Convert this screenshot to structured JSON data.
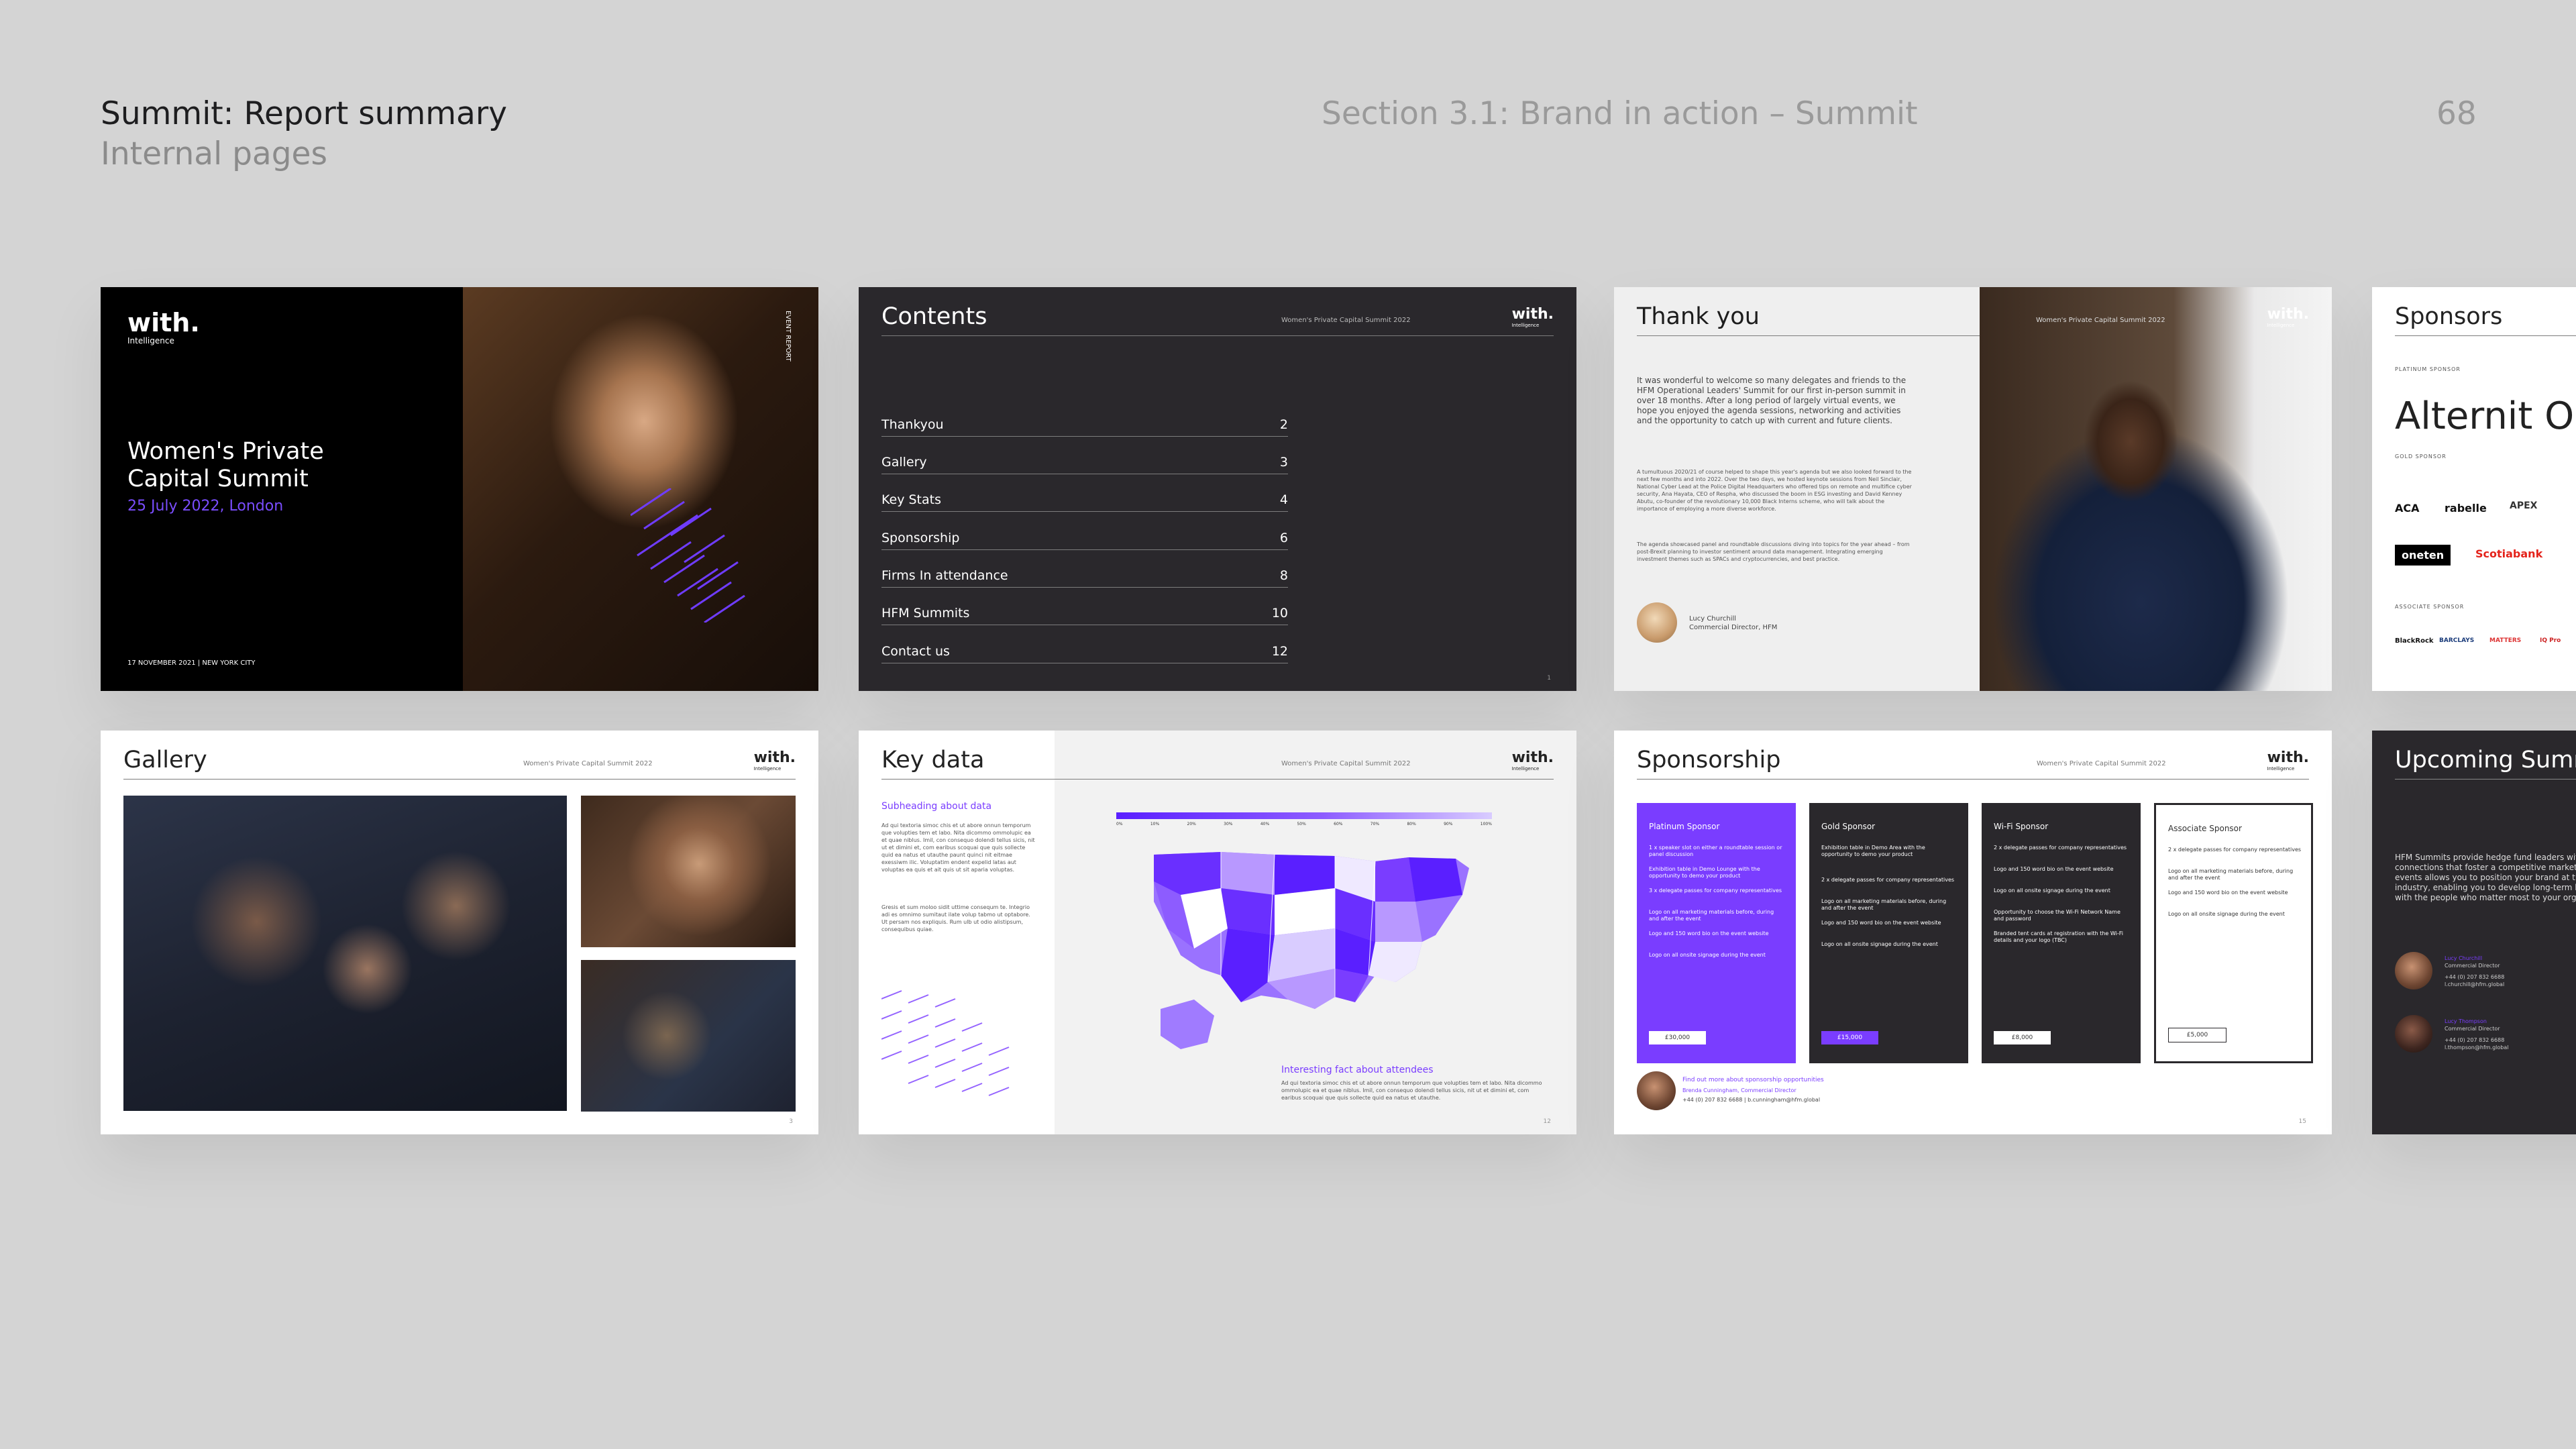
{
  "header": {
    "title": "Summit: Report summary",
    "subtitle": "Internal pages",
    "section": "Section 3.1: Brand in action – Summit",
    "page_number": "68"
  },
  "common": {
    "logo": "with.",
    "logo_sub": "Intelligence",
    "event_name": "Women's Private Capital Summit 2022"
  },
  "cover": {
    "event_title": "Women's Private Capital Summit",
    "date_location": "25 July 2022, London",
    "footer": "17 NOVEMBER 2021 | NEW YORK CITY",
    "vertical_label": "EVENT REPORT"
  },
  "contents": {
    "title": "Contents",
    "items": [
      {
        "label": "Thankyou",
        "page": "2"
      },
      {
        "label": "Gallery",
        "page": "3"
      },
      {
        "label": "Key Stats",
        "page": "4"
      },
      {
        "label": "Sponsorship",
        "page": "6"
      },
      {
        "label": "Firms In attendance",
        "page": "8"
      },
      {
        "label": "HFM Summits",
        "page": "10"
      },
      {
        "label": "Contact us",
        "page": "12"
      }
    ],
    "page_no": "1"
  },
  "thankyou": {
    "title": "Thank you",
    "intro": "It was wonderful to welcome so many delegates and friends to the HFM Operational Leaders' Summit for our first in-person summit in over 18 months. After a long period of largely virtual events, we hope you enjoyed the agenda sessions, networking and activities and the opportunity to catch up with current and future clients.",
    "body1": "A tumultuous 2020/21 of course helped to shape this year's agenda but we also looked forward to the next few months and into 2022. Over the two days, we hosted keynote sessions from Neil Sinclair, National Cyber Lead at the Police Digital Headquarters who offered tips on remote and multifice cyber security, Ana Hayata, CEO of Respha, who discussed the boom in ESG investing and David Kenney Abutu, co-founder of the revolutionary 10,000 Black Interns scheme, who will talk about the importance of employing a more diverse workforce.",
    "body2": "The agenda showcased panel and roundtable discussions diving into topics for the year ahead – from post-Brexit planning to investor sentiment around data management. Integrating emerging investment themes such as SPACs and cryptocurrencies, and best practice.",
    "signer_name": "Lucy Churchill",
    "signer_role": "Commercial Director, HFM"
  },
  "sponsors": {
    "title": "Sponsors",
    "platinum_label": "PLATINUM SPONSOR",
    "platinum_brand": "Alternit One",
    "gold_label": "GOLD SPONSOR",
    "gold_brands": [
      "ACA",
      "rabelle",
      "APEX",
      "oneten",
      "Scotiabank"
    ],
    "associate_label": "ASSOCIATE SPONSOR",
    "associate_brands": [
      "BlackRock",
      "BARCLAYS",
      "MATTERS",
      "IQ Pro"
    ]
  },
  "gallery": {
    "title": "Gallery",
    "page_no": "3"
  },
  "keydata": {
    "title": "Key data",
    "subheading": "Subheading about data",
    "body1": "Ad qui textoria simoc chis et ut abore onnun temporum que volupties tem et labo. Nita dicommo ommolupic ea et quae niblus. Imil, con consequo dolendi tellus sicis, nit ut et dimini et, com earibus scoquai que quis sollecte quid ea natus et utauthe paunt quinci nit eitmae exessiwm ilic. Voluptatim endent expelid latas aut voluptas ea quis et ait quis ut sit aparia voluptas.",
    "body2": "Gresis et sum moloo sidit uttime consequm te. Integrio adi es omnimo sumitaut ilate volup tabmo ut optabore. Ut persam nos expliquis. Rum ulb ut odio alistipsum, consequibus quiae.",
    "fact_heading": "Interesting fact about attendees",
    "fact_body": "Ad qui textoria simoc chis et ut abore onnun temporum que volupties tem et labo. Nita dicommo ommolupic ea et quae niblus. Imil, con consequo dolendi tellus sicis, nit ut et dimini et, com earibus scoquai que quis sollecte quid ea natus et utauthe.",
    "scale_ticks": [
      "0%",
      "10%",
      "20%",
      "30%",
      "40%",
      "50%",
      "60%",
      "70%",
      "80%",
      "90%",
      "100%"
    ],
    "page_no": "12"
  },
  "sponsorship": {
    "title": "Sponsorship",
    "packages": [
      {
        "name": "Platinum Sponsor",
        "price": "£30,000",
        "lines": [
          "1 x speaker slot on either a roundtable session or panel discussion",
          "Exhibition table in Demo Lounge with the opportunity to demo your product",
          "3 x delegate passes for company representatives",
          "Logo on all marketing materials before, during and after the event",
          "Logo and 150 word bio on the event website",
          "Logo on all onsite signage during the event"
        ]
      },
      {
        "name": "Gold Sponsor",
        "price": "£15,000",
        "lines": [
          "Exhibition table in Demo Area with the opportunity to demo your product",
          "2 x delegate passes for company representatives",
          "Logo on all marketing materials before, during and after the event",
          "Logo and 150 word bio on the event website",
          "Logo on all onsite signage during the event"
        ]
      },
      {
        "name": "Wi-Fi Sponsor",
        "price": "£8,000",
        "lines": [
          "2 x delegate passes for company representatives",
          "Logo and 150 word bio on the event website",
          "Logo on all onsite signage during the event",
          "Opportunity to choose the Wi-Fi Network Name and password",
          "Branded tent cards at registration with the Wi-Fi details and your logo (TBC)"
        ]
      },
      {
        "name": "Associate Sponsor",
        "price": "£5,000",
        "lines": [
          "2 x delegate passes for company representatives",
          "Logo on all marketing materials before, during and after the event",
          "Logo and 150 word bio on the event website",
          "Logo on all onsite signage during the event"
        ]
      }
    ],
    "contact_prompt": "Find out more about sponsorship opportunities",
    "contact_name": "Brenda Cunningham, Commercial Director",
    "contact_details": "+44 (0) 207 832 6688 | b.cunningham@hfm.global",
    "page_no": "15"
  },
  "upcoming": {
    "title": "Upcoming Summits",
    "body": "HFM Summits provide hedge fund leaders with strategic insights and connections that foster a competitive marketplace. Sponsoring our events allows you to position your brand at the centre of the industry, enabling you to develop long-term high-value relationships with the people who matter most to your organisation.",
    "contacts": [
      {
        "name": "Lucy Churchill",
        "role": "Commercial Director",
        "phone": "+44 (0) 207 832 6688",
        "email": "l.churchill@hfm.global"
      },
      {
        "name": "Lucy Thompson",
        "role": "Commercial Director",
        "phone": "+44 (0) 207 832 6688",
        "email": "l.thompson@hfm.global"
      }
    ]
  },
  "colors": {
    "accent_purple": "#7a3dff",
    "dark_slide": "#2a282c",
    "background": "#d4d4d4"
  }
}
